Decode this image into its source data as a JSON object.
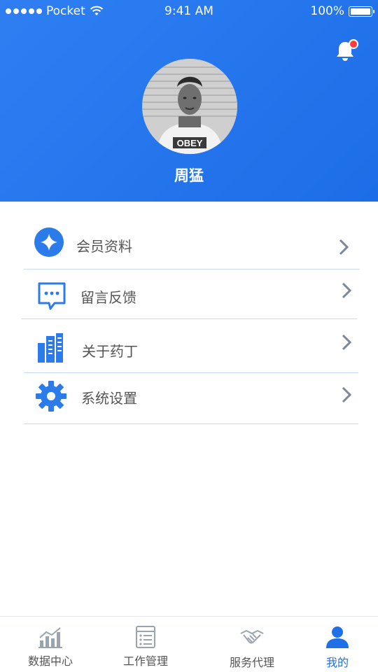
{
  "status_bar": {
    "carrier": "Pocket",
    "time": "9:41 AM",
    "battery": "100%"
  },
  "profile": {
    "name": "周猛",
    "avatar_shirt_text": "OBEY"
  },
  "notification": {
    "icon": "bell-icon",
    "has_unread": true
  },
  "menu": {
    "items": [
      {
        "label": "会员资料",
        "icon": "member-icon"
      },
      {
        "label": "留言反馈",
        "icon": "message-icon"
      },
      {
        "label": "关于药丁",
        "icon": "building-icon"
      },
      {
        "label": "系统设置",
        "icon": "gear-icon"
      }
    ]
  },
  "tabbar": {
    "tabs": [
      {
        "label": "数据中心",
        "icon": "chart-icon",
        "active": false
      },
      {
        "label": "工作管理",
        "icon": "list-icon",
        "active": false
      },
      {
        "label": "服务代理",
        "icon": "handshake-icon",
        "active": false
      },
      {
        "label": "我的",
        "icon": "user-icon",
        "active": true
      }
    ]
  },
  "colors": {
    "primary": "#1f6fe6",
    "header_gradient_start": "#2f7ff3",
    "header_gradient_end": "#1c6de7",
    "badge_red": "#ff3b3b",
    "divider": "#c8d9f2",
    "chevron": "#7d8797"
  }
}
